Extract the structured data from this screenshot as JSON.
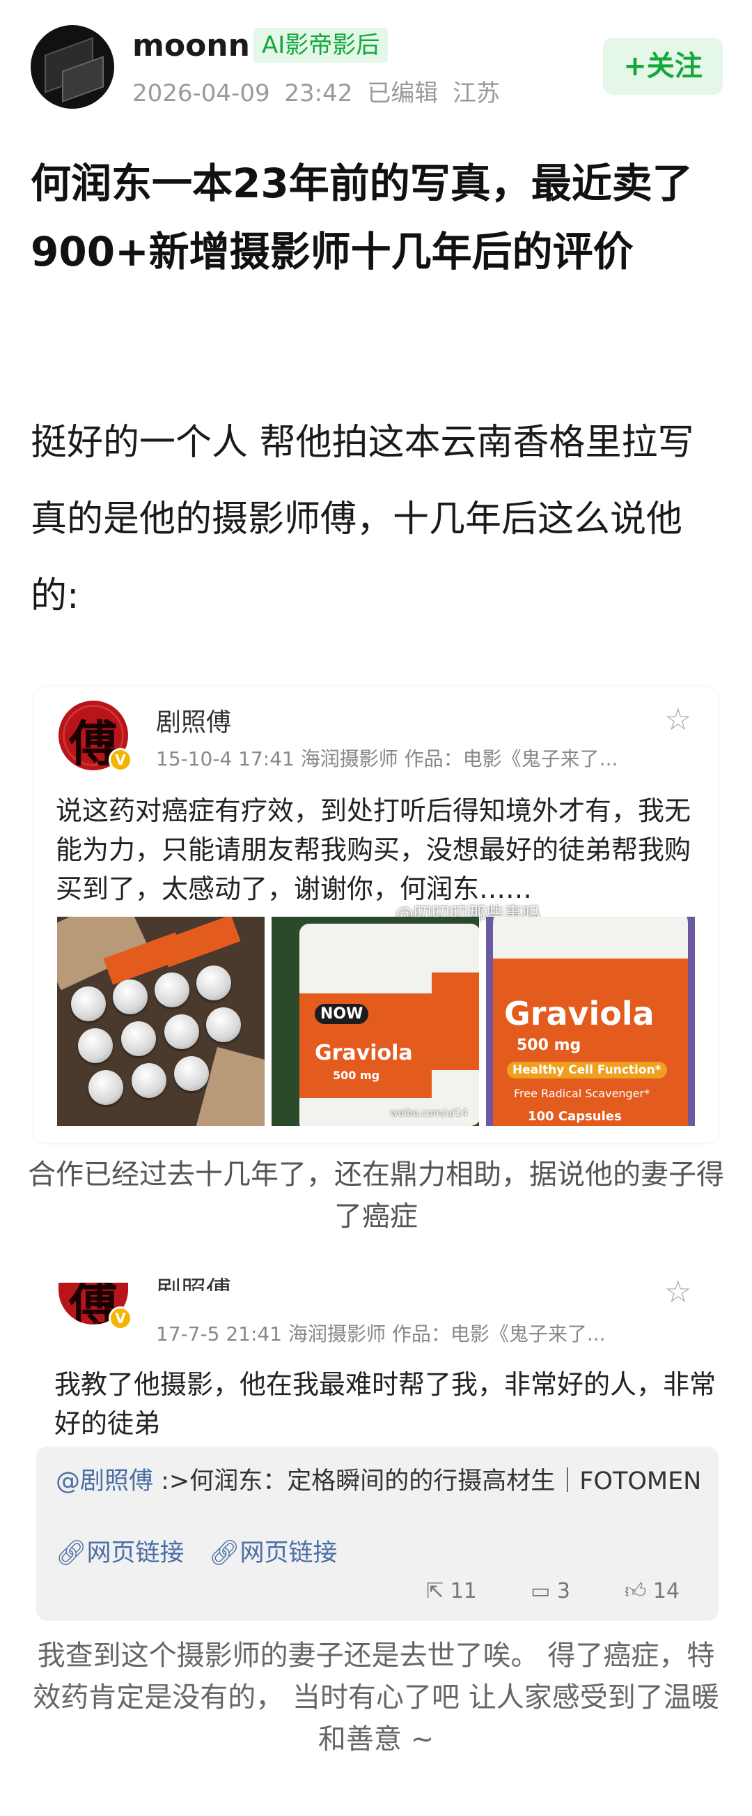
{
  "author": {
    "name": "moonn",
    "badge": "AI影帝影后",
    "date": "2026-04-09 23:42",
    "edited": "已编辑",
    "location": "江苏",
    "follow_label": "+关注"
  },
  "post": {
    "title": "何润东一本23年前的写真，最近卖了900+新增摄影师十几年后的评价",
    "body": "挺好的一个人 帮他拍这本云南香格里拉写真的是他的摄影师傅，十几年后这么说他的:"
  },
  "weibo_1": {
    "seal_glyph": "傅",
    "name": "剧照傅",
    "meta": "15-10-4 17:41   海润摄影师 作品：电影《鬼子来了...",
    "text": "说这药对癌症有疗效，到处打听后得知境外才有，我无能为力，只能请朋友帮我购买，没想最好的徒弟帮我购买到了，太感动了，谢谢你，何润东……",
    "watermark": "@叨叨叨那些事吗",
    "photo_watermark": "weibo.com/u/14",
    "label_brand": "NOW",
    "label_product": "Graviola",
    "label_dose": "500 mg",
    "label_tagline": "Healthy Cell Function*",
    "label_sub": "Free Radical Scavenger*",
    "label_count": "100 Capsules"
  },
  "caption_1": "合作已经过去十几年了，还在鼎力相助，据说他的妻子得了癌症",
  "weibo_2": {
    "seal_glyph": "傅",
    "name": "剧照傅",
    "meta": "17-7-5 21:41   海润摄影师 作品：电影《鬼子来了...",
    "text": "我教了他摄影，他在我最难时帮了我，非常好的人，非常好的徒弟",
    "ref_at": "@剧照傅",
    "ref_text": " :>何润东：定格瞬间的的行摄高材生｜FOTOMEN",
    "link_1": "网页链接",
    "link_2": "网页链接",
    "reposts": "11",
    "comments": "3",
    "likes": "14"
  },
  "caption_2": "我查到这个摄影师的妻子还是去世了唉。 得了癌症，特效药肯定是没有的， 当时有心了吧 让人家感受到了温暖和善意 ~",
  "colors": {
    "accent_green": "#14a83b",
    "badge_bg": "#e4f7e8",
    "link_blue": "#4a6fa5",
    "seal_red": "#b8151b",
    "label_orange": "#e45b1e"
  }
}
